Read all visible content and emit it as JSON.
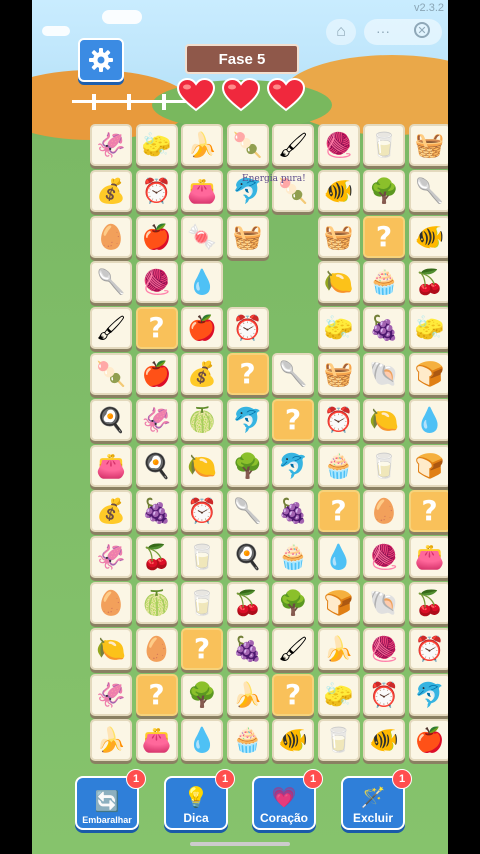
{
  "version": "v2.3.2",
  "level_label": "Fase 5",
  "lives": 3,
  "float_text": "Energia pura!",
  "icons": {
    "settings": "gear-icon",
    "home": "home-icon",
    "more": "more-icon",
    "close": "close-icon"
  },
  "tiles": [
    {
      "r": 0,
      "c": 0,
      "item": "squid",
      "g": "🦑"
    },
    {
      "r": 0,
      "c": 1,
      "item": "sponge",
      "g": "🧽"
    },
    {
      "r": 0,
      "c": 2,
      "item": "banana",
      "g": "🍌"
    },
    {
      "r": 0,
      "c": 3,
      "item": "popsicle",
      "g": "🍡"
    },
    {
      "r": 0,
      "c": 4,
      "item": "brush",
      "g": "🖌"
    },
    {
      "r": 0,
      "c": 5,
      "item": "yarn",
      "g": "🧶"
    },
    {
      "r": 0,
      "c": 6,
      "item": "cup",
      "g": "🥛"
    },
    {
      "r": 0,
      "c": 7,
      "item": "basket",
      "g": "🧺"
    },
    {
      "r": 1,
      "c": 0,
      "item": "sack",
      "g": "💰"
    },
    {
      "r": 1,
      "c": 1,
      "item": "clock",
      "g": "⏰"
    },
    {
      "r": 1,
      "c": 2,
      "item": "purse",
      "g": "👛"
    },
    {
      "r": 1,
      "c": 3,
      "item": "dolphin",
      "g": "🐬"
    },
    {
      "r": 1,
      "c": 4,
      "item": "popsicle",
      "g": "🍡"
    },
    {
      "r": 1,
      "c": 5,
      "item": "fish",
      "g": "🐠"
    },
    {
      "r": 1,
      "c": 6,
      "item": "tree",
      "g": "🌳"
    },
    {
      "r": 1,
      "c": 7,
      "item": "spoon",
      "g": "🥄"
    },
    {
      "r": 2,
      "c": 0,
      "item": "egg",
      "g": "🥚"
    },
    {
      "r": 2,
      "c": 1,
      "item": "apple",
      "g": "🍎"
    },
    {
      "r": 2,
      "c": 2,
      "item": "candy",
      "g": "🍬"
    },
    {
      "r": 2,
      "c": 3,
      "item": "basket",
      "g": "🧺"
    },
    {
      "r": 2,
      "c": 5,
      "item": "basket",
      "g": "🧺"
    },
    {
      "r": 2,
      "c": 6,
      "item": "mystery",
      "g": "?"
    },
    {
      "r": 2,
      "c": 7,
      "item": "fish",
      "g": "🐠"
    },
    {
      "r": 3,
      "c": 0,
      "item": "spoon",
      "g": "🥄"
    },
    {
      "r": 3,
      "c": 1,
      "item": "yarn",
      "g": "🧶"
    },
    {
      "r": 3,
      "c": 2,
      "item": "drop",
      "g": "💧"
    },
    {
      "r": 3,
      "c": 5,
      "item": "lemon",
      "g": "🍋"
    },
    {
      "r": 3,
      "c": 6,
      "item": "cupcake",
      "g": "🧁"
    },
    {
      "r": 3,
      "c": 7,
      "item": "cherry",
      "g": "🍒"
    },
    {
      "r": 4,
      "c": 0,
      "item": "brush",
      "g": "🖌"
    },
    {
      "r": 4,
      "c": 1,
      "item": "mystery",
      "g": "?"
    },
    {
      "r": 4,
      "c": 2,
      "item": "apple",
      "g": "🍎"
    },
    {
      "r": 4,
      "c": 3,
      "item": "clock",
      "g": "⏰"
    },
    {
      "r": 4,
      "c": 5,
      "item": "sponge",
      "g": "🧽"
    },
    {
      "r": 4,
      "c": 6,
      "item": "grapes",
      "g": "🍇"
    },
    {
      "r": 4,
      "c": 7,
      "item": "sponge",
      "g": "🧽"
    },
    {
      "r": 5,
      "c": 0,
      "item": "popsicle",
      "g": "🍡"
    },
    {
      "r": 5,
      "c": 1,
      "item": "apple",
      "g": "🍎"
    },
    {
      "r": 5,
      "c": 2,
      "item": "sack",
      "g": "💰"
    },
    {
      "r": 5,
      "c": 3,
      "item": "mystery",
      "g": "?"
    },
    {
      "r": 5,
      "c": 4,
      "item": "spoon",
      "g": "🥄"
    },
    {
      "r": 5,
      "c": 5,
      "item": "basket",
      "g": "🧺"
    },
    {
      "r": 5,
      "c": 6,
      "item": "shell",
      "g": "🐚"
    },
    {
      "r": 5,
      "c": 7,
      "item": "bread",
      "g": "🍞"
    },
    {
      "r": 6,
      "c": 0,
      "item": "pan",
      "g": "🍳"
    },
    {
      "r": 6,
      "c": 1,
      "item": "squid",
      "g": "🦑"
    },
    {
      "r": 6,
      "c": 2,
      "item": "melon",
      "g": "🍈"
    },
    {
      "r": 6,
      "c": 3,
      "item": "dolphin",
      "g": "🐬"
    },
    {
      "r": 6,
      "c": 4,
      "item": "mystery",
      "g": "?"
    },
    {
      "r": 6,
      "c": 5,
      "item": "clock",
      "g": "⏰"
    },
    {
      "r": 6,
      "c": 6,
      "item": "lemon",
      "g": "🍋"
    },
    {
      "r": 6,
      "c": 7,
      "item": "drop",
      "g": "💧"
    },
    {
      "r": 7,
      "c": 0,
      "item": "purse",
      "g": "👛"
    },
    {
      "r": 7,
      "c": 1,
      "item": "pan",
      "g": "🍳"
    },
    {
      "r": 7,
      "c": 2,
      "item": "lemon",
      "g": "🍋"
    },
    {
      "r": 7,
      "c": 3,
      "item": "tree",
      "g": "🌳"
    },
    {
      "r": 7,
      "c": 4,
      "item": "dolphin",
      "g": "🐬"
    },
    {
      "r": 7,
      "c": 5,
      "item": "cupcake",
      "g": "🧁"
    },
    {
      "r": 7,
      "c": 6,
      "item": "cup",
      "g": "🥛"
    },
    {
      "r": 7,
      "c": 7,
      "item": "bread",
      "g": "🍞"
    },
    {
      "r": 8,
      "c": 0,
      "item": "sack",
      "g": "💰"
    },
    {
      "r": 8,
      "c": 1,
      "item": "grapes",
      "g": "🍇"
    },
    {
      "r": 8,
      "c": 2,
      "item": "clock",
      "g": "⏰"
    },
    {
      "r": 8,
      "c": 3,
      "item": "spoon",
      "g": "🥄"
    },
    {
      "r": 8,
      "c": 4,
      "item": "grapes",
      "g": "🍇"
    },
    {
      "r": 8,
      "c": 5,
      "item": "mystery",
      "g": "?"
    },
    {
      "r": 8,
      "c": 6,
      "item": "egg",
      "g": "🥚"
    },
    {
      "r": 8,
      "c": 7,
      "item": "mystery",
      "g": "?"
    },
    {
      "r": 9,
      "c": 0,
      "item": "squid",
      "g": "🦑"
    },
    {
      "r": 9,
      "c": 1,
      "item": "cherry",
      "g": "🍒"
    },
    {
      "r": 9,
      "c": 2,
      "item": "cup",
      "g": "🥛"
    },
    {
      "r": 9,
      "c": 3,
      "item": "pan",
      "g": "🍳"
    },
    {
      "r": 9,
      "c": 4,
      "item": "cupcake",
      "g": "🧁"
    },
    {
      "r": 9,
      "c": 5,
      "item": "drop",
      "g": "💧"
    },
    {
      "r": 9,
      "c": 6,
      "item": "yarn",
      "g": "🧶"
    },
    {
      "r": 9,
      "c": 7,
      "item": "purse",
      "g": "👛"
    },
    {
      "r": 10,
      "c": 0,
      "item": "egg",
      "g": "🥚"
    },
    {
      "r": 10,
      "c": 1,
      "item": "melon",
      "g": "🍈"
    },
    {
      "r": 10,
      "c": 2,
      "item": "cup",
      "g": "🥛"
    },
    {
      "r": 10,
      "c": 3,
      "item": "cherry",
      "g": "🍒"
    },
    {
      "r": 10,
      "c": 4,
      "item": "tree",
      "g": "🌳"
    },
    {
      "r": 10,
      "c": 5,
      "item": "bread",
      "g": "🍞"
    },
    {
      "r": 10,
      "c": 6,
      "item": "shell",
      "g": "🐚"
    },
    {
      "r": 10,
      "c": 7,
      "item": "cherry",
      "g": "🍒"
    },
    {
      "r": 11,
      "c": 0,
      "item": "lemon",
      "g": "🍋"
    },
    {
      "r": 11,
      "c": 1,
      "item": "egg",
      "g": "🥚"
    },
    {
      "r": 11,
      "c": 2,
      "item": "mystery",
      "g": "?"
    },
    {
      "r": 11,
      "c": 3,
      "item": "grapes",
      "g": "🍇"
    },
    {
      "r": 11,
      "c": 4,
      "item": "brush",
      "g": "🖌"
    },
    {
      "r": 11,
      "c": 5,
      "item": "banana",
      "g": "🍌"
    },
    {
      "r": 11,
      "c": 6,
      "item": "yarn",
      "g": "🧶"
    },
    {
      "r": 11,
      "c": 7,
      "item": "clock",
      "g": "⏰"
    },
    {
      "r": 12,
      "c": 0,
      "item": "squid",
      "g": "🦑"
    },
    {
      "r": 12,
      "c": 1,
      "item": "mystery",
      "g": "?"
    },
    {
      "r": 12,
      "c": 2,
      "item": "tree",
      "g": "🌳"
    },
    {
      "r": 12,
      "c": 3,
      "item": "banana",
      "g": "🍌"
    },
    {
      "r": 12,
      "c": 4,
      "item": "mystery",
      "g": "?"
    },
    {
      "r": 12,
      "c": 5,
      "item": "sponge",
      "g": "🧽"
    },
    {
      "r": 12,
      "c": 6,
      "item": "clock",
      "g": "⏰"
    },
    {
      "r": 12,
      "c": 7,
      "item": "dolphin",
      "g": "🐬"
    },
    {
      "r": 13,
      "c": 0,
      "item": "banana",
      "g": "🍌"
    },
    {
      "r": 13,
      "c": 1,
      "item": "purse",
      "g": "👛"
    },
    {
      "r": 13,
      "c": 2,
      "item": "drop",
      "g": "💧"
    },
    {
      "r": 13,
      "c": 3,
      "item": "cupcake",
      "g": "🧁"
    },
    {
      "r": 13,
      "c": 4,
      "item": "fish",
      "g": "🐠"
    },
    {
      "r": 13,
      "c": 5,
      "item": "cup",
      "g": "🥛"
    },
    {
      "r": 13,
      "c": 6,
      "item": "fish",
      "g": "🐠"
    },
    {
      "r": 13,
      "c": 7,
      "item": "apple",
      "g": "🍎"
    }
  ],
  "powerups": [
    {
      "id": "shuffle",
      "label": "Embaralhar",
      "count": "1",
      "icon": "shuffle-icon",
      "g": "🔄"
    },
    {
      "id": "hint",
      "label": "Dica",
      "count": "1",
      "icon": "lightbulb-icon",
      "g": "💡"
    },
    {
      "id": "heart",
      "label": "Coração",
      "count": "1",
      "icon": "heart-plus-icon",
      "g": "💗"
    },
    {
      "id": "remove",
      "label": "Excluir",
      "count": "1",
      "icon": "magic-wand-icon",
      "g": "🪄"
    }
  ]
}
